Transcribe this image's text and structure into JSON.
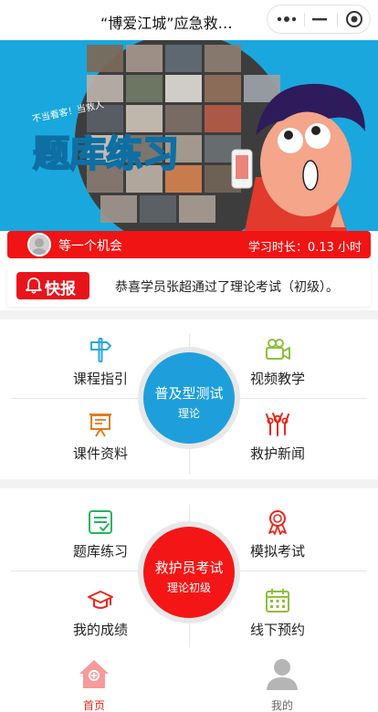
{
  "navbar": {
    "title": "“博爱江城”应急救…"
  },
  "banner": {
    "title": "题库练习",
    "slogan": "不当看客！当救人"
  },
  "userbar": {
    "username": "等一个机会",
    "study_time": "学习时长：0.13 小时"
  },
  "notice": {
    "tag": "快报",
    "text": "恭喜学员张超通过了理论考试（初级）。"
  },
  "section1": {
    "top_left": "课程指引",
    "top_right": "视频教学",
    "bottom_left": "课件资料",
    "bottom_right": "救护新闻",
    "center_title": "普及型测试",
    "center_sub": "理论"
  },
  "section2": {
    "top_left": "题库练习",
    "top_right": "模拟考试",
    "bottom_left": "我的成绩",
    "bottom_right": "线下预约",
    "center_title": "救护员考试",
    "center_sub": "理论初级"
  },
  "tabbar": {
    "home": "首页",
    "mine": "我的"
  },
  "colors": {
    "brand_red": "#f01414",
    "banner_blue": "#1aa7de",
    "center_blue": "#1e9fdb",
    "center_red": "#f41616",
    "icon_blue": "#28a7df",
    "icon_green": "#8dbf3c",
    "icon_orange": "#e07a1f",
    "icon_red": "#e8281c",
    "icon_teal": "#26b35f"
  }
}
